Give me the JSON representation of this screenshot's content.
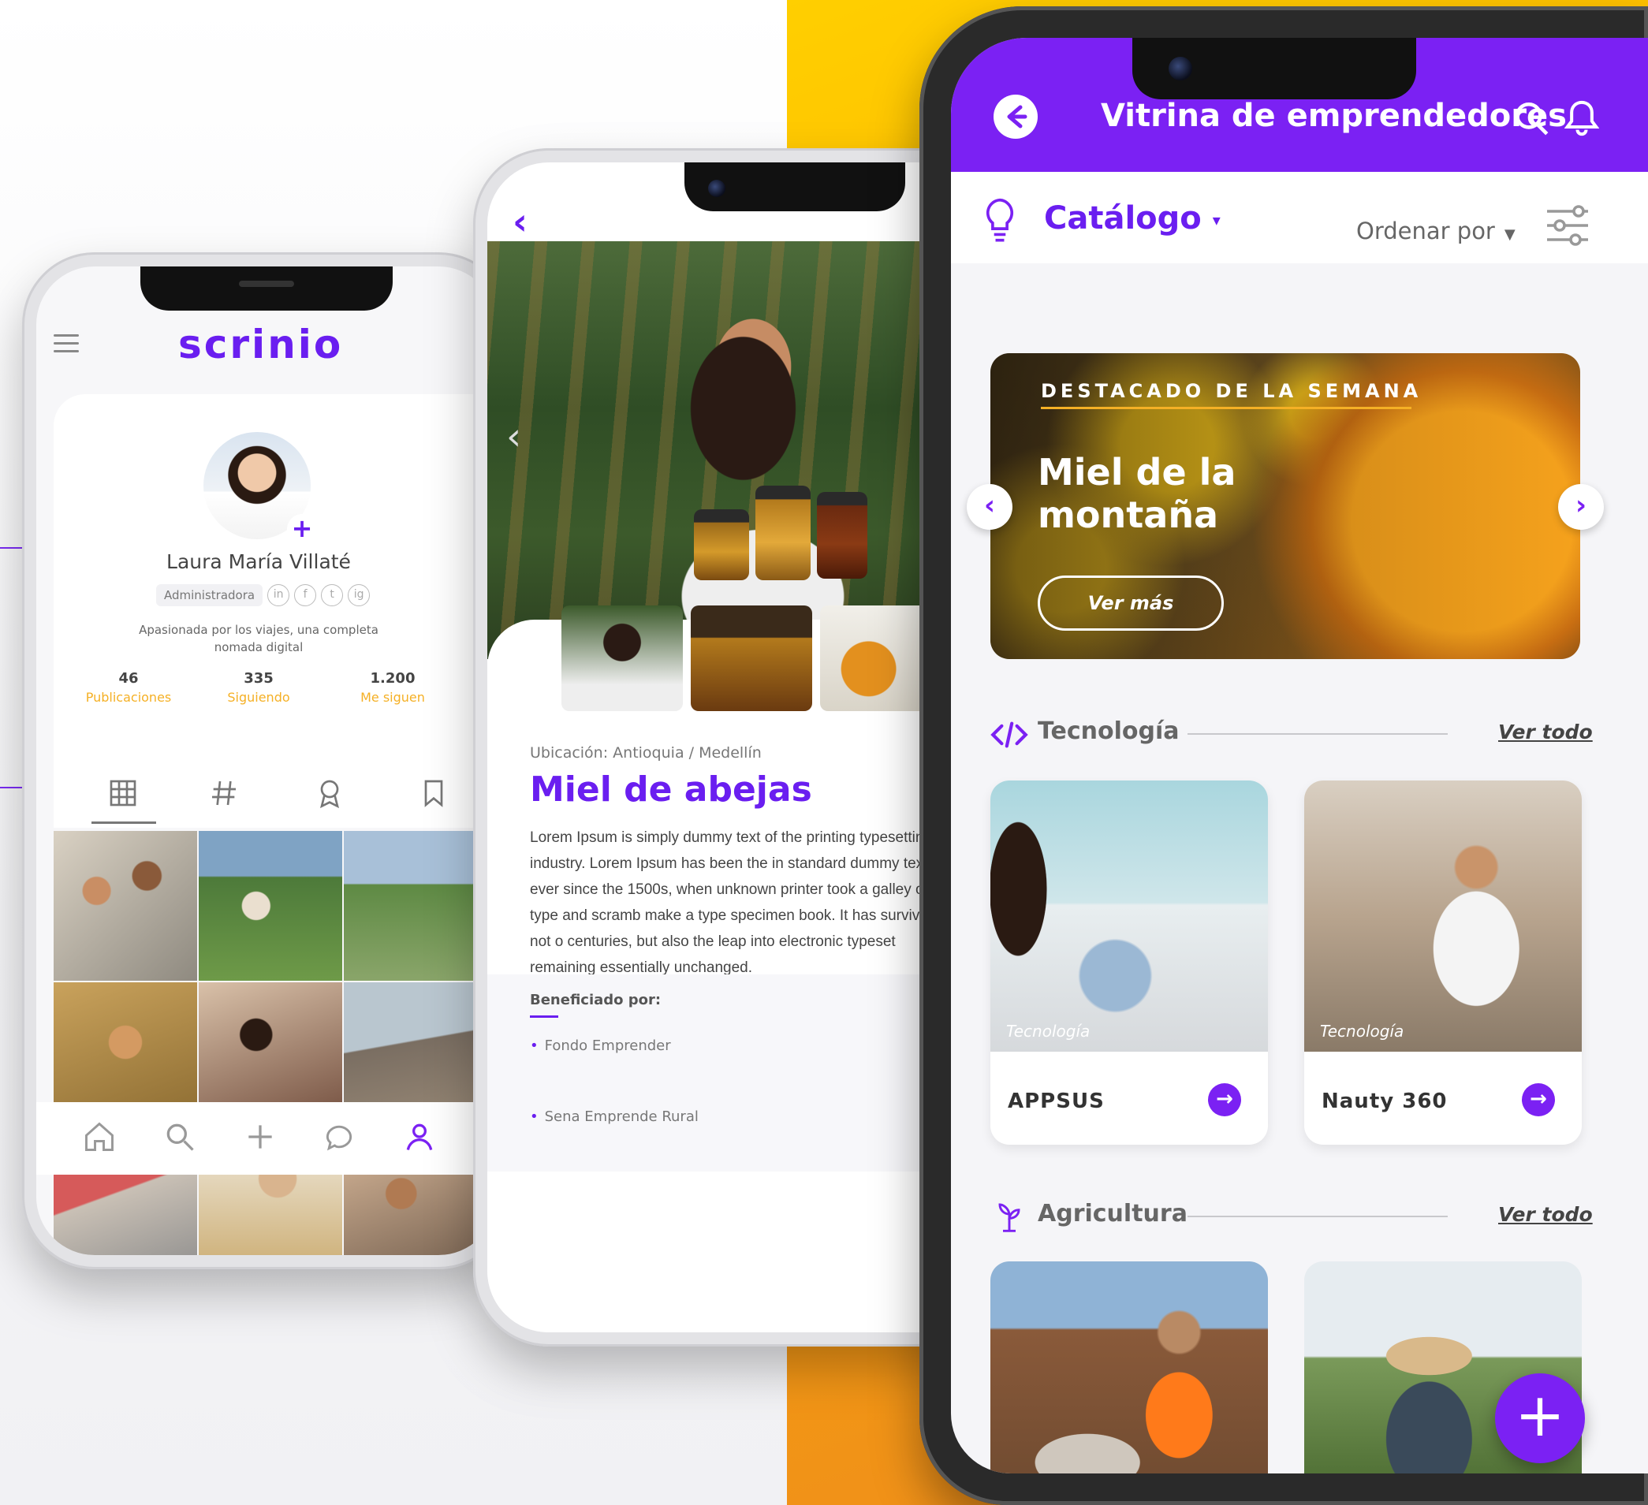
{
  "profile_app": {
    "logo": "scrinio",
    "user": {
      "name": "Laura María Villaté",
      "role": "Administradora",
      "bio": "Apasionada por los viajes, una completa nomada digital",
      "social": [
        "in",
        "f",
        "t",
        "ig"
      ]
    },
    "stats": [
      {
        "value": "46",
        "label": "Publicaciones"
      },
      {
        "value": "335",
        "label": "Siguiendo"
      },
      {
        "value": "1.200",
        "label": "Me siguen"
      }
    ],
    "tabs": [
      "grid-icon",
      "hashtag-icon",
      "badge-icon",
      "bookmark-icon"
    ],
    "bottom_nav": [
      "home-icon",
      "search-icon",
      "plus-icon",
      "chat-icon",
      "user-icon"
    ]
  },
  "product_app": {
    "location": "Ubicación: Antioquia / Medellín",
    "title": "Miel de abejas",
    "description": "Lorem Ipsum is simply dummy text of the printing typesetting industry. Lorem Ipsum has been the in standard dummy text ever since the 1500s, when unknown printer took a galley of type and scramb make a type specimen book. It has survived not o centuries, but also the leap into electronic typeset remaining essentially unchanged.",
    "beneficiary_label": "Beneficiado por:",
    "beneficiaries": [
      "Fondo Emprender",
      "Sena Emprende Rural"
    ]
  },
  "catalog_app": {
    "header_title": "Vitrina de emprendedores",
    "catalog_label": "Catálogo",
    "order_label": "Ordenar por",
    "featured": {
      "kicker": "DESTACADO DE LA SEMANA",
      "title": "Miel de la montaña",
      "button": "Ver más"
    },
    "sections": [
      {
        "name": "Tecnología",
        "icon": "code-icon",
        "more": "Ver todo",
        "cards": [
          {
            "tag": "Tecnología",
            "name": "APPSUS"
          },
          {
            "tag": "Tecnología",
            "name": "Nauty 360"
          }
        ]
      },
      {
        "name": "Agricultura",
        "icon": "plant-icon",
        "more": "Ver todo"
      }
    ],
    "fab": "+"
  },
  "colors": {
    "brand_purple": "#7b21f3",
    "accent_yellow": "#f5b025",
    "background_orange": "#ffb300"
  }
}
